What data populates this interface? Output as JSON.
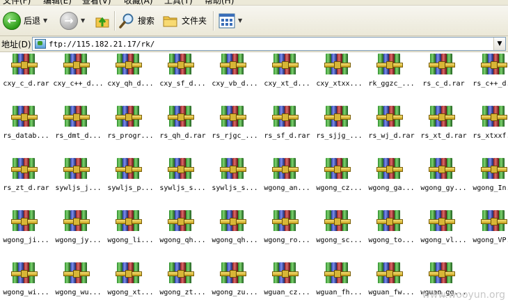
{
  "menu": [
    "文件(F)",
    "编辑(E)",
    "查看(V)",
    "收藏(A)",
    "工具(T)",
    "帮助(H)"
  ],
  "toolbar": {
    "back_label": "后退",
    "search_label": "搜索",
    "folders_label": "文件夹"
  },
  "address": {
    "label": "地址(D)",
    "value": "ftp://115.182.21.17/rk/"
  },
  "files": [
    "cxy_c_d.rar",
    "cxy_c++_d...",
    "cxy_qh_d...",
    "cxy_sf_d...",
    "cxy_vb_d...",
    "cxy_xt_d...",
    "cxy_xtxx...",
    "rk_ggzc_...",
    "rs_c_d.rar",
    "rs_c++_d...",
    "rs_datab...",
    "rs_dmt_d...",
    "rs_progr...",
    "rs_qh_d.rar",
    "rs_rjgc_...",
    "rs_sf_d.rar",
    "rs_sjjg_...",
    "rs_wj_d.rar",
    "rs_xt_d.rar",
    "rs_xtxxf...",
    "rs_zt_d.rar",
    "sywljs_j...",
    "sywljs_p...",
    "sywljs_s...",
    "sywljs_s...",
    "wgong_an...",
    "wgong_cz...",
    "wgong_ga...",
    "wgong_gy...",
    "wgong_In...",
    "wgong_ji...",
    "wgong_jy...",
    "wgong_li...",
    "wgong_qh...",
    "wgong_qh...",
    "wgong_ro...",
    "wgong_sc...",
    "wgong_to...",
    "wgong_vl...",
    "wgong_VP...",
    "wgong_wi...",
    "wgong_wu...",
    "wgong_xt...",
    "wgong_zt...",
    "wgong_zu...",
    "wguan_cz...",
    "wguan_fh...",
    "wguan_fw...",
    "wguan_gg..."
  ],
  "watermark": "www.wooyun.org"
}
